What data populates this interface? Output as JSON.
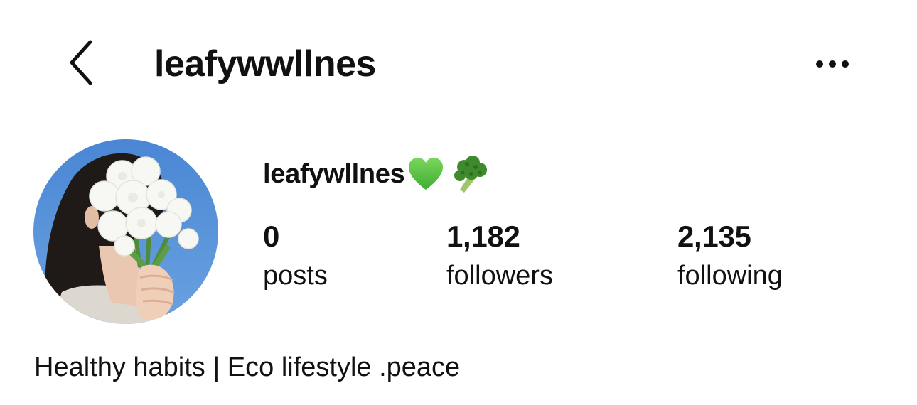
{
  "header": {
    "back_icon": "chevron-left-icon",
    "title": "leafywwllnes",
    "more_icon": "more-horizontal-icon"
  },
  "profile": {
    "avatar_description_icon": "profile-photo",
    "display_name": "leafywllnes",
    "name_emojis": [
      "green-heart-icon",
      "broccoli-icon"
    ],
    "stats": [
      {
        "count": "0",
        "label": "posts"
      },
      {
        "count": "1,182",
        "label": "followers"
      },
      {
        "count": "2,135",
        "label": "following"
      }
    ],
    "bio": "Healthy habits | Eco lifestyle .peace"
  },
  "colors": {
    "text": "#111111",
    "background": "#ffffff",
    "sky": "#4f8bd6",
    "heart": "#58c645",
    "broccoli": "#3f8a2c"
  }
}
